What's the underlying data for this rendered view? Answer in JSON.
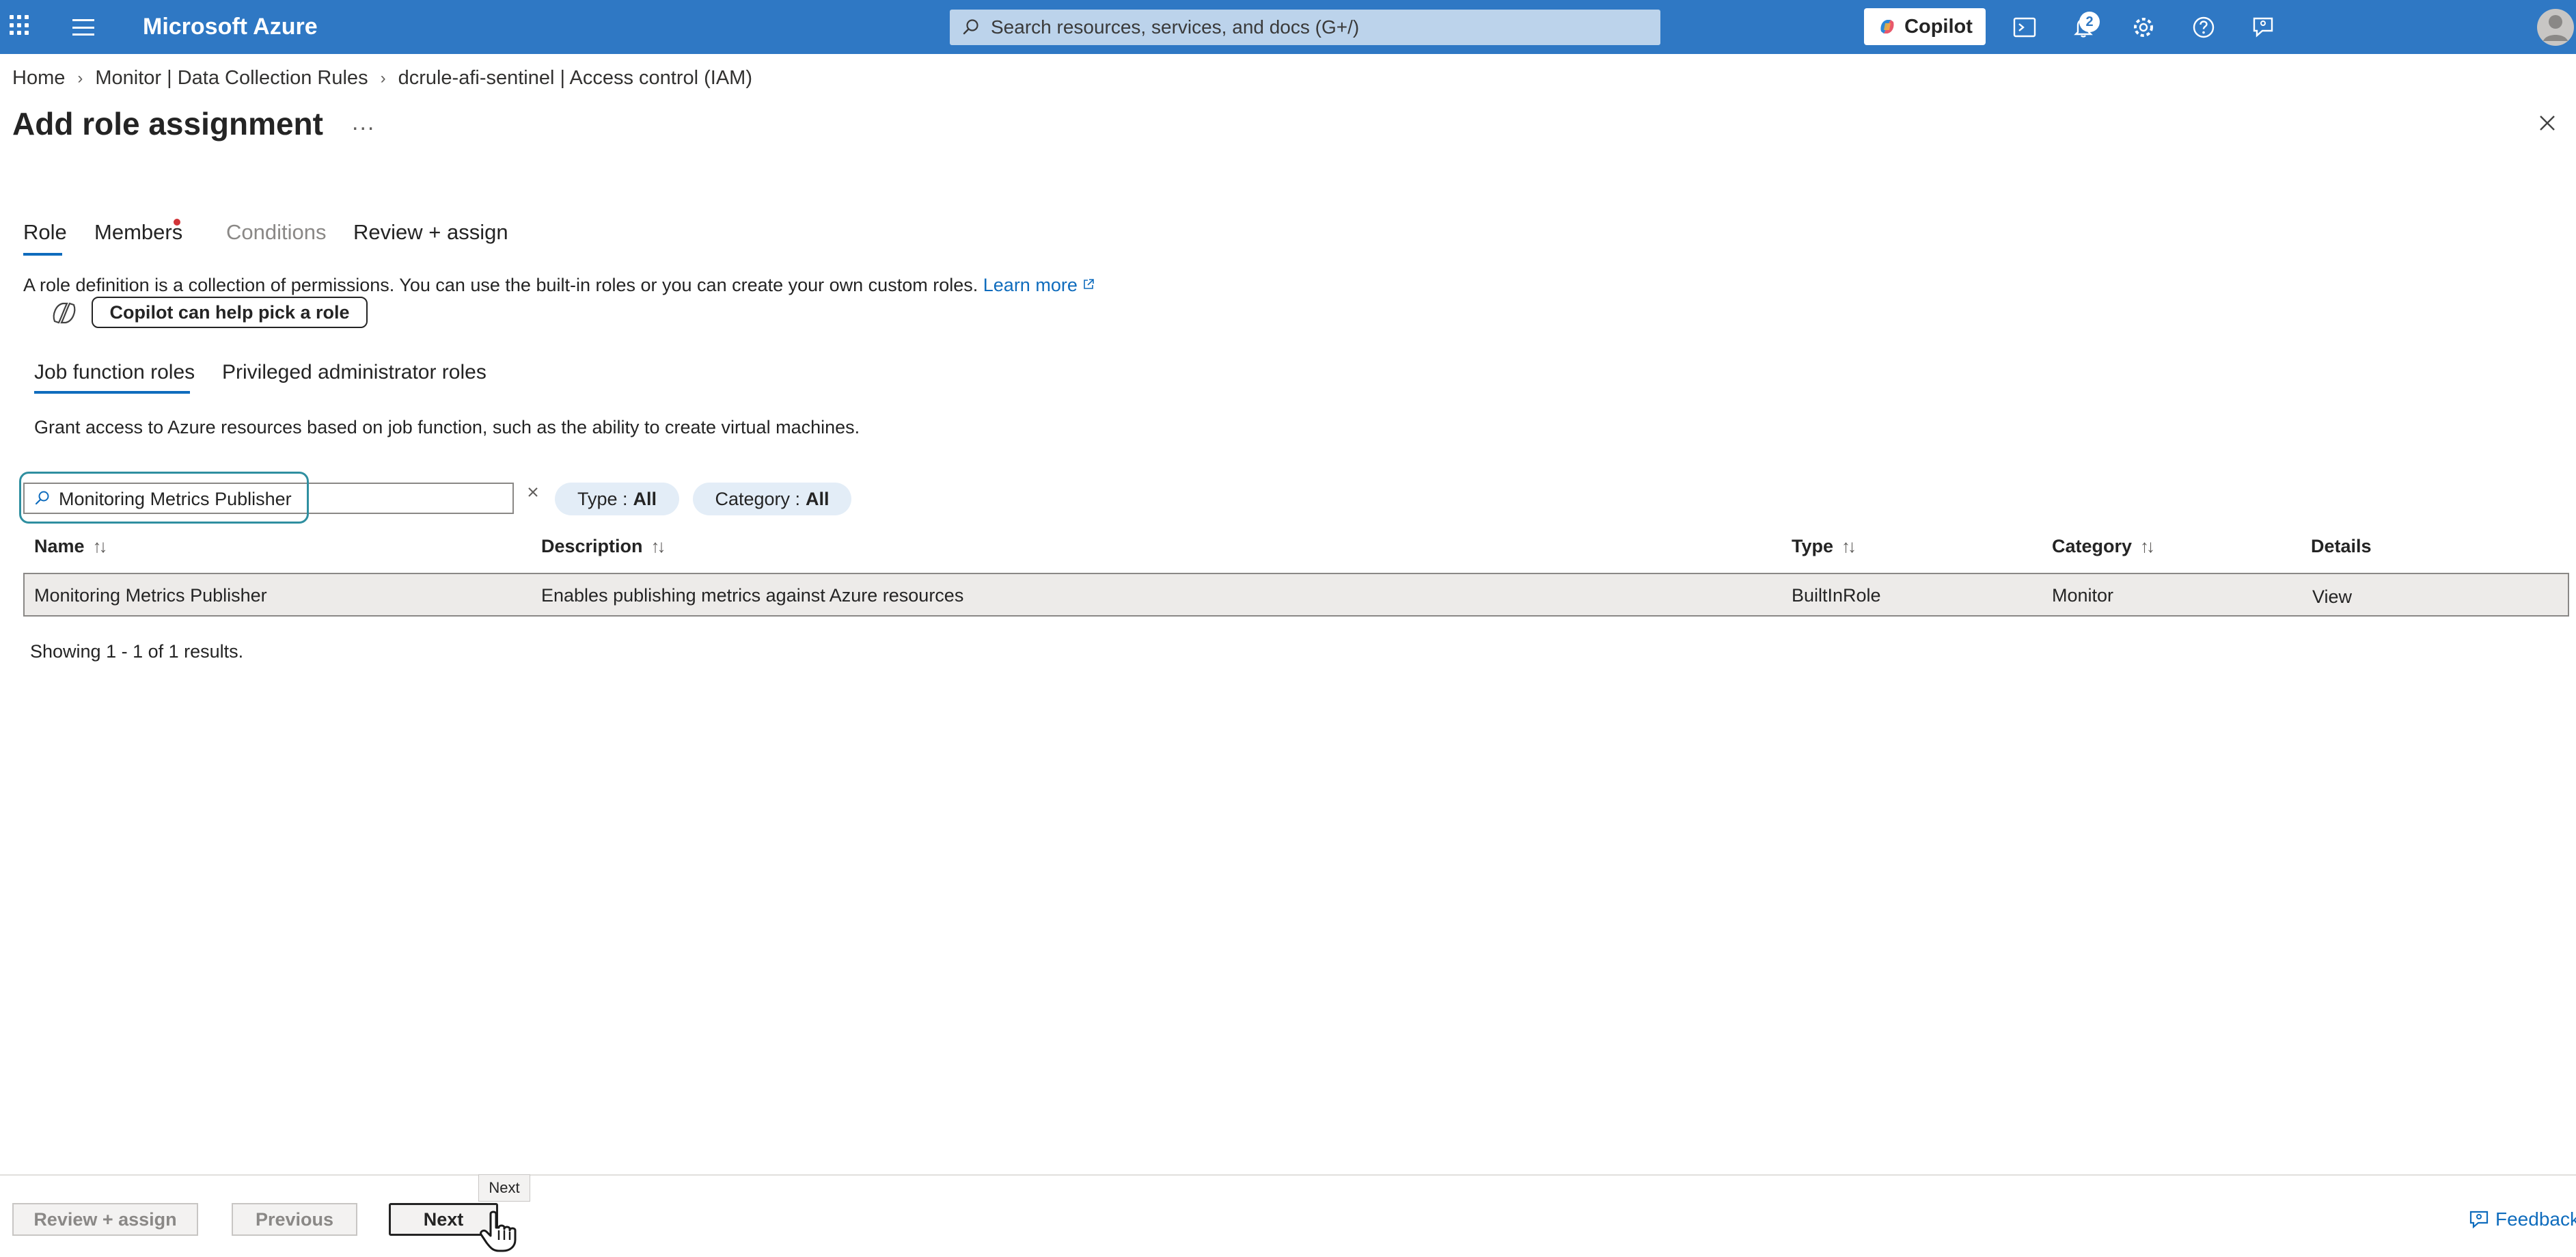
{
  "topbar": {
    "brand": "Microsoft Azure",
    "search_placeholder": "Search resources, services, and docs (G+/)",
    "copilot_label": "Copilot",
    "notification_count": "2",
    "bar_color": "#2f78c4"
  },
  "breadcrumb": [
    "Home",
    "Monitor | Data Collection Rules",
    "dcrule-afi-sentinel | Access control (IAM)"
  ],
  "page": {
    "title": "Add role assignment",
    "more_label": "..."
  },
  "steps": {
    "role": "Role",
    "members": "Members",
    "conditions": "Conditions",
    "review": "Review + assign"
  },
  "role_info": {
    "description": "A role definition is a collection of permissions. You can use the built-in roles or you can create your own custom roles.",
    "learn_more": "Learn more",
    "copilot_pick": "Copilot can help pick a role"
  },
  "sub_tabs": {
    "job": "Job function roles",
    "privileged": "Privileged administrator roles"
  },
  "grant_text": "Grant access to Azure resources based on job function, such as the ability to create virtual machines.",
  "filter": {
    "value": "Monitoring Metrics Publisher",
    "type_label": "Type : ",
    "type_value": "All",
    "category_label": "Category : ",
    "category_value": "All"
  },
  "table": {
    "headers": {
      "name": "Name",
      "description": "Description",
      "type": "Type",
      "category": "Category",
      "details": "Details"
    },
    "rows": [
      {
        "name": "Monitoring Metrics Publisher",
        "description": "Enables publishing metrics against Azure resources",
        "type": "BuiltInRole",
        "category": "Monitor",
        "details": "View"
      }
    ],
    "showing": "Showing 1 - 1 of 1 results."
  },
  "footer": {
    "review_assign": "Review + assign",
    "previous": "Previous",
    "next": "Next",
    "tooltip": "Next",
    "feedback": "Feedback"
  }
}
